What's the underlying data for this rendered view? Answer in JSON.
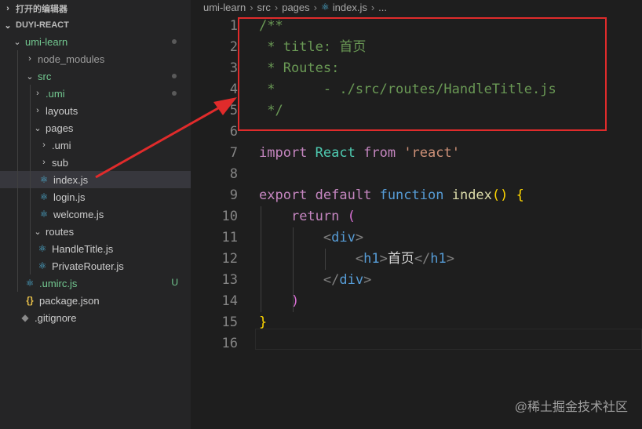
{
  "explorer": {
    "open_editors": "打开的编辑器",
    "project": "DUYI-REACT",
    "items": [
      {
        "label": "umi-learn"
      },
      {
        "label": "node_modules"
      },
      {
        "label": "src"
      },
      {
        "label": ".umi"
      },
      {
        "label": "layouts"
      },
      {
        "label": "pages"
      },
      {
        "label": ".umi"
      },
      {
        "label": "sub"
      },
      {
        "label": "index.js"
      },
      {
        "label": "login.js"
      },
      {
        "label": "welcome.js"
      },
      {
        "label": "routes"
      },
      {
        "label": "HandleTitle.js"
      },
      {
        "label": "PrivateRouter.js"
      },
      {
        "label": ".umirc.js",
        "badge": "U"
      },
      {
        "label": "package.json",
        "icon_text": "{}"
      },
      {
        "label": ".gitignore"
      }
    ]
  },
  "breadcrumb": [
    "umi-learn",
    "src",
    "pages",
    "index.js",
    "..."
  ],
  "editor": {
    "line_numbers": [
      "1",
      "2",
      "3",
      "4",
      "5",
      "6",
      "7",
      "8",
      "9",
      "10",
      "11",
      "12",
      "13",
      "14",
      "15",
      "16"
    ],
    "line1": "/**",
    "line2": " * title: 首页",
    "line3": " * Routes:",
    "line4": " *      - ./src/routes/HandleTitle.js",
    "line5": " */",
    "line7": {
      "kw": "import",
      "name": "React",
      "from": "from",
      "str": "'react'"
    },
    "line9": {
      "kw1": "export",
      "kw2": "default",
      "kw3": "function",
      "fn": "index",
      "paren": "()",
      "brace": "{"
    },
    "line10": {
      "kw": "return",
      "paren": "("
    },
    "line11": {
      "lt": "<",
      "tag": "div",
      "gt": ">"
    },
    "line12": {
      "lt": "<",
      "tag": "h1",
      "gt": ">",
      "text": "首页",
      "lt2": "</",
      "tag2": "h1",
      "gt2": ">"
    },
    "line13": {
      "lt": "</",
      "tag": "div",
      "gt": ">"
    },
    "line14": {
      "paren": ")"
    },
    "line15": {
      "brace": "}"
    }
  },
  "watermark": "@稀土掘金技术社区",
  "colors": {
    "highlight_box": "#e02b2b",
    "arrow": "#e02b2b"
  }
}
